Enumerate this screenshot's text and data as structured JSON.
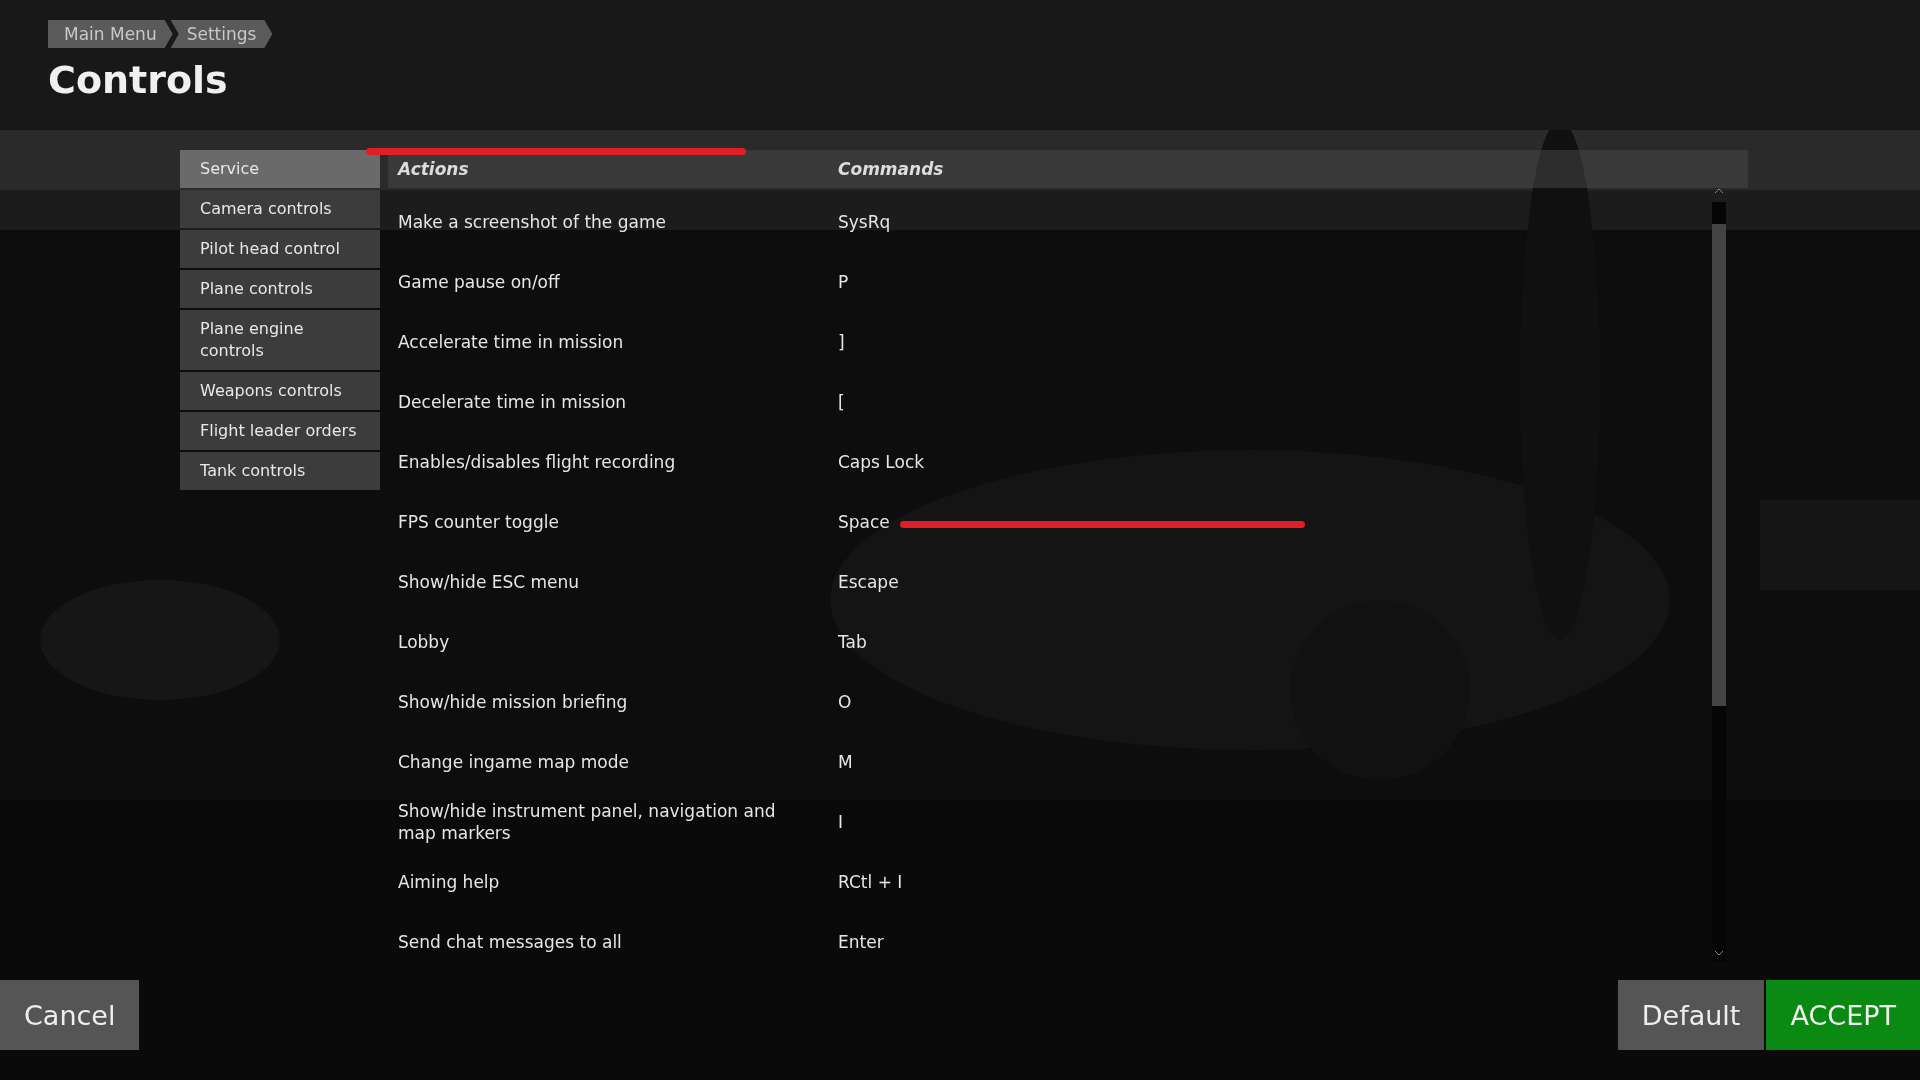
{
  "breadcrumb": [
    "Main Menu",
    "Settings"
  ],
  "title": "Controls",
  "categories": [
    {
      "label": "Service",
      "selected": true
    },
    {
      "label": "Camera controls",
      "selected": false
    },
    {
      "label": "Pilot head control",
      "selected": false
    },
    {
      "label": "Plane controls",
      "selected": false
    },
    {
      "label": "Plane engine controls",
      "selected": false
    },
    {
      "label": "Weapons controls",
      "selected": false
    },
    {
      "label": "Flight leader orders",
      "selected": false
    },
    {
      "label": "Tank controls",
      "selected": false
    }
  ],
  "table": {
    "columns": [
      "Actions",
      "Commands"
    ],
    "rows": [
      {
        "action": "Make a screenshot of the game",
        "command": "SysRq"
      },
      {
        "action": "Game pause on/off",
        "command": "P"
      },
      {
        "action": "Accelerate time in mission",
        "command": "]"
      },
      {
        "action": "Decelerate time in mission",
        "command": "["
      },
      {
        "action": "Enables/disables flight recording",
        "command": "Caps Lock"
      },
      {
        "action": "FPS counter toggle",
        "command": "Space"
      },
      {
        "action": "Show/hide ESC menu",
        "command": "Escape"
      },
      {
        "action": "Lobby",
        "command": "Tab"
      },
      {
        "action": "Show/hide mission briefing",
        "command": "O"
      },
      {
        "action": "Change ingame map mode",
        "command": "M"
      },
      {
        "action": "Show/hide instrument panel, navigation and map markers",
        "command": "I"
      },
      {
        "action": "Aiming help",
        "command": "RCtl + I"
      },
      {
        "action": "Send chat messages to all",
        "command": "Enter"
      }
    ]
  },
  "buttons": {
    "cancel": "Cancel",
    "default": "Default",
    "accept": "ACCEPT"
  }
}
